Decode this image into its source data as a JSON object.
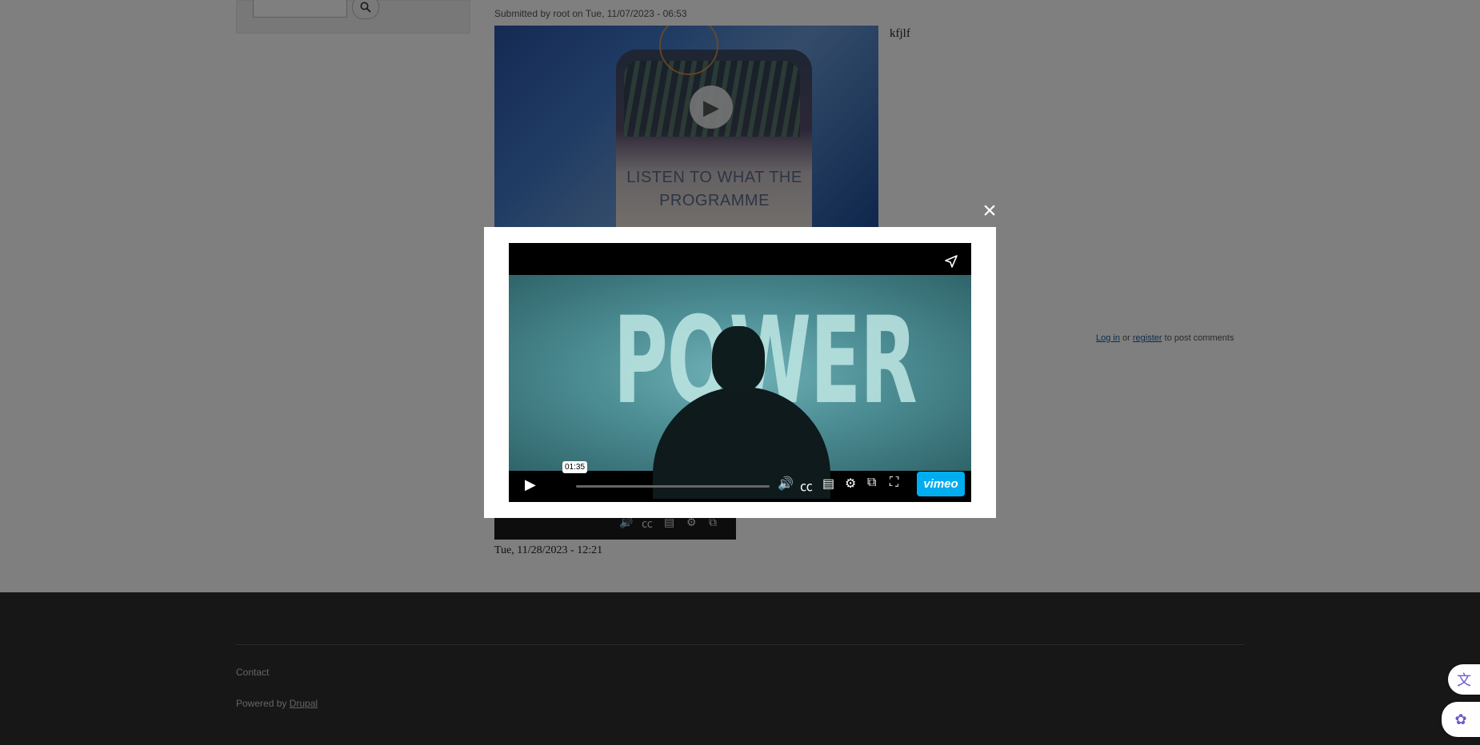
{
  "sidebar": {
    "search_placeholder": ""
  },
  "node": {
    "submitted": "Submitted by root on Tue, 11/07/2023 - 06:53",
    "thumbnail_text": "LISTEN TO WHAT THE PROGRAMME",
    "body_text": "kfjlf",
    "second_date": "Tue, 11/28/2023 - 12:21"
  },
  "comments": {
    "login_label": "Log in",
    "or_label": "or",
    "register_label": "register",
    "suffix": "to post comments"
  },
  "footer": {
    "contact_label": "Contact",
    "powered_prefix": "Powered by",
    "powered_link": "Drupal"
  },
  "modal": {
    "close_symbol": "×",
    "video_frame_text": "POWER",
    "hover_time": "01:35",
    "vimeo_label": "vimeo"
  },
  "icons": {
    "search": "search-icon",
    "close": "close-icon",
    "share": "share-icon",
    "play": "play-icon",
    "volume": "volume-icon",
    "captions": "cc-icon",
    "transcript": "transcript-icon",
    "settings": "gear-icon",
    "pip": "picture-in-picture-icon",
    "fullscreen": "fullscreen-icon",
    "translate": "translate-icon",
    "brain": "brain-icon"
  },
  "colors": {
    "vimeo_brand": "#00adef",
    "link": "#1a5a9c",
    "footer_bg": "#2f2f2f"
  }
}
